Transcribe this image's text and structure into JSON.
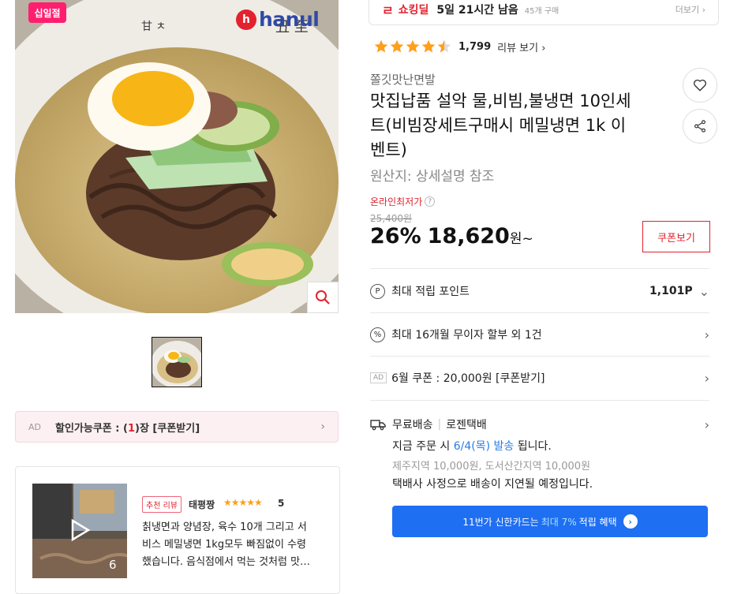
{
  "left": {
    "badge_label": "십일절",
    "brand_mark": "h",
    "brand_text": "hanul",
    "coupon_bar": {
      "ad": "AD",
      "prefix": "할인가능쿠폰 : (",
      "count": "1",
      "suffix": ")장 [쿠폰받기]"
    },
    "review": {
      "tag": "추천 리뷰",
      "user": "태평짱",
      "stars": "★★★★★",
      "score": "5",
      "media_count": "6",
      "lines": [
        "칡냉면과 양념장, 육수 10개 그리고 서",
        "비스 메밀냉면 1kg모두 빠짐없이 수령",
        "했습니다. 음식점에서 먹는 것처럼 맛…"
      ]
    }
  },
  "deal": {
    "title": "쇼킹딜",
    "time": "5일 21시간 남음",
    "count": "45개 구매",
    "more": "더보기 ›"
  },
  "rating": {
    "value": 4.5,
    "count": "1,799",
    "link": "리뷰 보기 ›"
  },
  "product": {
    "seller": "쫄깃맛난면발",
    "title_lines": [
      "맛집납품 설악 물,비빔,불냉면 10인세",
      "트(비빔장세트구매시 메밀냉면 1k 이",
      "벤트)"
    ],
    "origin": "원산지: 상세설명 참조"
  },
  "price": {
    "lowest_label": "온라인최저가",
    "help": "?",
    "original": "25,400원",
    "discount": "26%",
    "amount": "18,620",
    "unit": "원~",
    "coupon_button": "쿠폰보기"
  },
  "benefits": {
    "points": {
      "icon": "P",
      "label": "최대 적립 포인트",
      "value": "1,101P"
    },
    "installment": {
      "icon": "%",
      "label": "최대 16개월 무이자 할부 외 1건"
    },
    "coupon": {
      "ad": "AD",
      "label": "6월 쿠폰 : 20,000원 [쿠폰받기]"
    }
  },
  "shipping": {
    "free": "무료배송",
    "carrier": "로젠택배",
    "prefix": "지금 주문 시 ",
    "date": "6/4(목) 발송",
    "suffix": " 됩니다.",
    "extra": "제주지역 10,000원, 도서산간지역 10,000원",
    "notice": "택배사 사정으로 배송이 지연될 예정입니다."
  },
  "card_banner": {
    "prefix": "11번가 신한카드는",
    "highlight": "최대 7%",
    "suffix": "적립 혜택",
    "arrow": "›"
  },
  "colors": {
    "accent_red": "#e2222e",
    "star": "#ff9f1c",
    "banner_blue": "#1f6ff2",
    "link_blue": "#2b7be4"
  }
}
